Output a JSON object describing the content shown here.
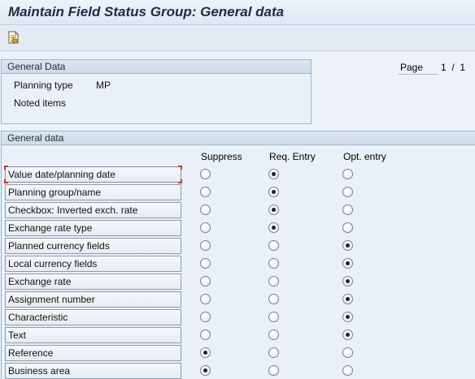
{
  "window": {
    "title": "Maintain Field Status Group: General data"
  },
  "toolbar": {
    "buttons": [
      {
        "icon": "document-transfer-icon"
      }
    ]
  },
  "general_data_header": {
    "title": "General Data",
    "planning_type_label": "Planning type",
    "planning_type_value": "MP",
    "noted_items_label": "Noted items"
  },
  "page_info": {
    "label": "Page",
    "current": "1",
    "separator": "/",
    "total": "1"
  },
  "general_data_section": {
    "title": "General data",
    "columns": [
      "Suppress",
      "Req. Entry",
      "Opt. entry"
    ],
    "rows": [
      {
        "label": "Value date/planning date",
        "selected": "Req. Entry"
      },
      {
        "label": "Planning group/name",
        "selected": "Req. Entry"
      },
      {
        "label": "Checkbox: Inverted exch. rate",
        "selected": "Req. Entry"
      },
      {
        "label": "Exchange rate type",
        "selected": "Req. Entry"
      },
      {
        "label": "Planned currency fields",
        "selected": "Opt. entry"
      },
      {
        "label": "Local currency fields",
        "selected": "Opt. entry"
      },
      {
        "label": "Exchange rate",
        "selected": "Opt. entry"
      },
      {
        "label": "Assignment number",
        "selected": "Opt. entry"
      },
      {
        "label": "Characteristic",
        "selected": "Opt. entry"
      },
      {
        "label": "Text",
        "selected": "Opt. entry"
      },
      {
        "label": "Reference",
        "selected": "Suppress"
      },
      {
        "label": "Business area",
        "selected": "Suppress"
      }
    ]
  },
  "colors": {
    "focus_marker": "#d0342c",
    "group_border": "#9fb4cd"
  }
}
